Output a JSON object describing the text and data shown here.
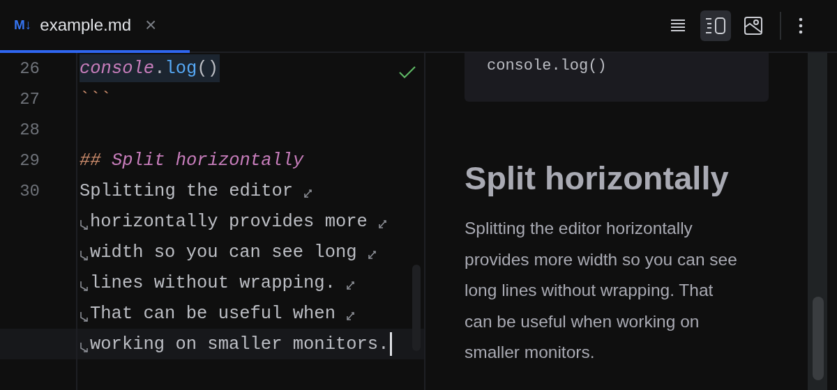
{
  "tab": {
    "badge": "M↓",
    "title": "example.md",
    "close": "×",
    "selected": true
  },
  "view_modes": [
    {
      "kind": "editor",
      "selected": false
    },
    {
      "kind": "split",
      "selected": true
    },
    {
      "kind": "preview",
      "selected": false
    }
  ],
  "editor": {
    "lines": [
      {
        "number": "26",
        "tokens": [
          {
            "kind": "object",
            "text": "console"
          },
          {
            "kind": "punct",
            "text": "."
          },
          {
            "kind": "method",
            "text": "log"
          },
          {
            "kind": "plain",
            "text": "()"
          }
        ],
        "highlighted": true
      },
      {
        "number": "27",
        "tokens": [
          {
            "kind": "fence",
            "text": "```"
          }
        ],
        "highlighted": false
      },
      {
        "number": "28",
        "highlighted": false
      },
      {
        "number": "29",
        "tokens": [
          {
            "kind": "marker",
            "text": "## "
          },
          {
            "kind": "heading",
            "text": "Split horizontally"
          }
        ],
        "highlighted": false
      },
      {
        "number": "30",
        "wrap_start": false,
        "wrap_end": true,
        "tokens": [
          {
            "kind": "plain",
            "text": "Splitting the editor"
          }
        ],
        "highlighted": false
      },
      {
        "wrap_start": true,
        "wrap_end": true,
        "tokens": [
          {
            "kind": "plain",
            "text": "horizontally provides more"
          }
        ],
        "highlighted": false
      },
      {
        "wrap_start": true,
        "wrap_end": true,
        "tokens": [
          {
            "kind": "plain",
            "text": "width so you can see long"
          }
        ],
        "highlighted": false
      },
      {
        "wrap_start": true,
        "wrap_end": true,
        "tokens": [
          {
            "kind": "plain",
            "text": "lines without wrapping."
          }
        ],
        "highlighted": false
      },
      {
        "wrap_start": true,
        "wrap_end": true,
        "tokens": [
          {
            "kind": "plain",
            "text": "That can be useful when"
          }
        ],
        "highlighted": false
      },
      {
        "wrap_start": true,
        "wrap_end": false,
        "current": true,
        "tokens": [
          {
            "kind": "plain",
            "text": "working on smaller monitors."
          }
        ],
        "highlighted": false
      }
    ],
    "checked": true
  },
  "preview": {
    "code": "console.log()",
    "heading": "Split horizontally",
    "paragraph": "Splitting the editor horizontally provides more width so you can see long lines without wrapping. That can be useful when working on smaller monitors."
  }
}
